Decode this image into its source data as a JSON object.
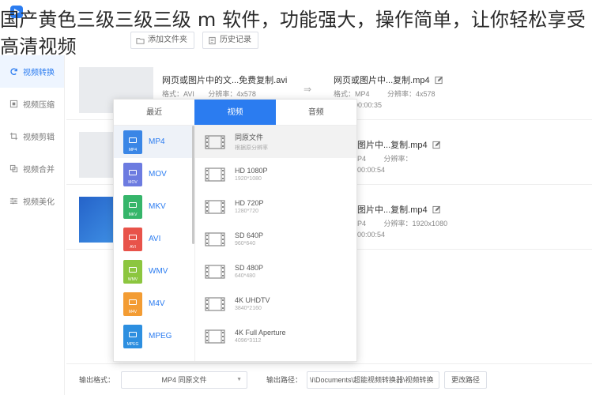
{
  "headline": "国产黄色三级三级三级 m 软件，功能强大，操作简单，让你轻松享受高清视频",
  "toolbar": {
    "add_label": "添加",
    "add_folder_label": "添加文件夹",
    "history_label": "历史记录"
  },
  "sidebar": {
    "items": [
      {
        "label": "视频转换",
        "icon": "refresh-icon"
      },
      {
        "label": "视频压缩",
        "icon": "compress-icon"
      },
      {
        "label": "视频剪辑",
        "icon": "crop-icon"
      },
      {
        "label": "视频合并",
        "icon": "merge-icon"
      },
      {
        "label": "视频美化",
        "icon": "sliders-icon"
      }
    ]
  },
  "files": [
    {
      "src_name": "网页或图片中的文...免费复制.avi",
      "src_format": "格式：AVI",
      "src_res": "分辨率：4x578",
      "dst_name": "网页或图片中...复制.mp4",
      "dst_format": "格式：MP4",
      "dst_res": "分辨率：4x578",
      "dst_duration": "00:00:35"
    },
    {
      "dst_name": "图片中...复制.mp4",
      "dst_format": "P4",
      "dst_res": "分辨率：",
      "dst_duration": "00:00:54"
    },
    {
      "dst_name": "图片中...复制.mp4",
      "dst_format": "P4",
      "dst_res": "分辨率：1920x1080",
      "dst_duration": "00:00:54"
    }
  ],
  "dropdown": {
    "tabs": [
      "最近",
      "视频",
      "音频"
    ],
    "active_tab": "视频",
    "formats": [
      {
        "name": "MP4",
        "label": "MP4",
        "color": "#3a86e6"
      },
      {
        "name": "MOV",
        "label": "MOV",
        "color": "#6c7be0"
      },
      {
        "name": "MKV",
        "label": "MKV",
        "color": "#35b56a"
      },
      {
        "name": "AVI",
        "label": "AVI",
        "color": "#e8534a"
      },
      {
        "name": "WMV",
        "label": "WMV",
        "color": "#8cc63f"
      },
      {
        "name": "M4V",
        "label": "M4V",
        "color": "#f39c33"
      },
      {
        "name": "MPEG",
        "label": "MPEG",
        "color": "#2d8fe0"
      }
    ],
    "resolutions": [
      {
        "name": "同原文件",
        "sub": "根据原分辨率"
      },
      {
        "name": "HD 1080P",
        "sub": "1920*1080"
      },
      {
        "name": "HD 720P",
        "sub": "1280*720"
      },
      {
        "name": "SD 640P",
        "sub": "960*640"
      },
      {
        "name": "SD 480P",
        "sub": "640*480"
      },
      {
        "name": "4K UHDTV",
        "sub": "3840*2160"
      },
      {
        "name": "4K Full Aperture",
        "sub": "4096*3112"
      }
    ]
  },
  "bottom": {
    "format_label": "输出格式：",
    "format_value": "MP4 同原文件",
    "path_label": "输出路径：",
    "path_value": "\\i\\Documents\\超能视频转换器\\视频转换",
    "change_path_label": "更改路径"
  },
  "colors": {
    "accent": "#2b7cf0"
  }
}
